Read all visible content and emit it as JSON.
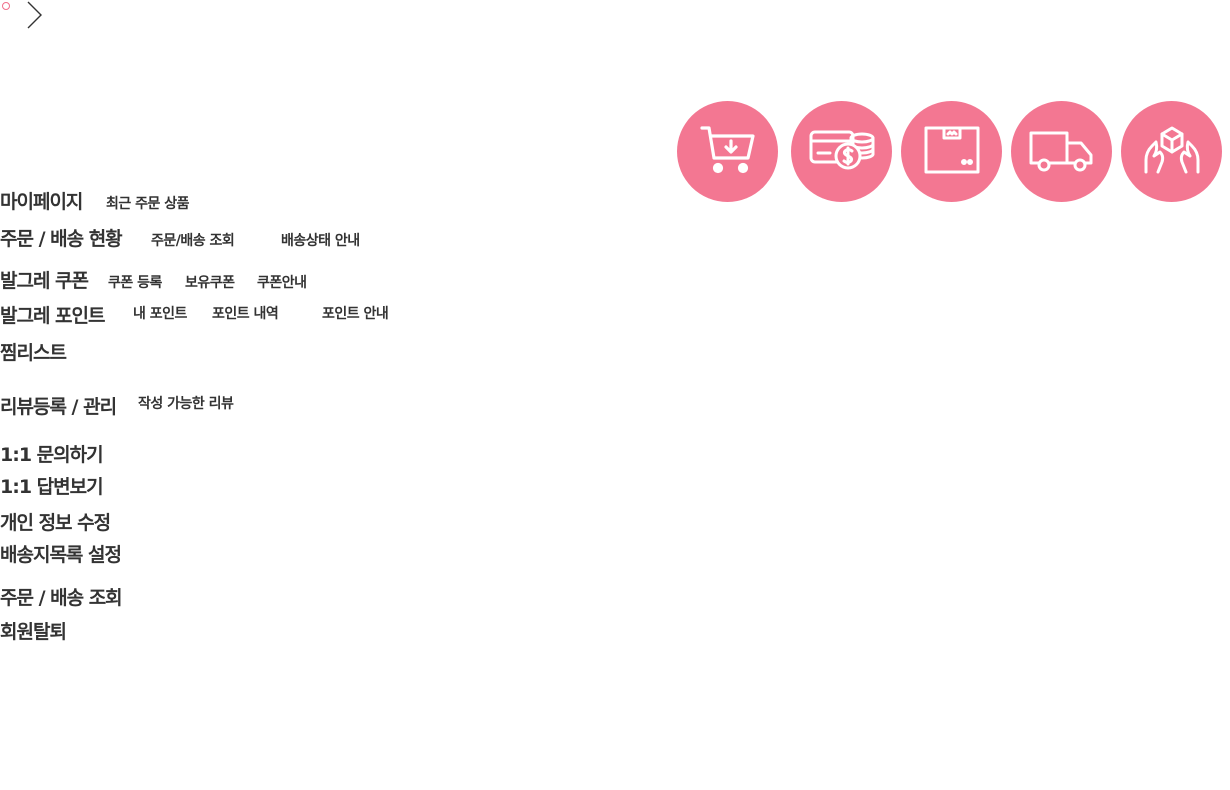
{
  "colors": {
    "accent": "#f37792",
    "text": "#333333",
    "icon_stroke": "#ffffff"
  },
  "icons": [
    {
      "name": "cart-download-icon"
    },
    {
      "name": "card-coin-icon"
    },
    {
      "name": "box-icon"
    },
    {
      "name": "delivery-truck-icon"
    },
    {
      "name": "hands-box-icon"
    }
  ],
  "menu": {
    "mypage": {
      "label": "마이페이지",
      "subs": [
        "최근 주문 상품"
      ]
    },
    "order_status": {
      "label": "주문 / 배송 현황",
      "subs": [
        "주문/배송 조회",
        "배송상태 안내"
      ]
    },
    "coupon": {
      "label": "발그레 쿠폰",
      "subs": [
        "쿠폰 등록",
        "보유쿠폰",
        "쿠폰안내"
      ]
    },
    "point": {
      "label": "발그레 포인트",
      "subs": [
        "내 포인트",
        "포인트 내역",
        "포인트 안내"
      ]
    },
    "wishlist": {
      "label": "찜리스트"
    },
    "review": {
      "label": "리뷰등록 / 관리",
      "subs": [
        "작성 가능한 리뷰"
      ]
    },
    "inquiry": {
      "label": "1:1 문의하기"
    },
    "answers": {
      "label": "1:1 답변보기"
    },
    "profile": {
      "label": "개인 정보 수정"
    },
    "address": {
      "label": "배송지목록 설정"
    },
    "order_lookup": {
      "label": "주문 / 배송 조회"
    },
    "withdraw": {
      "label": "회원탈퇴"
    }
  }
}
